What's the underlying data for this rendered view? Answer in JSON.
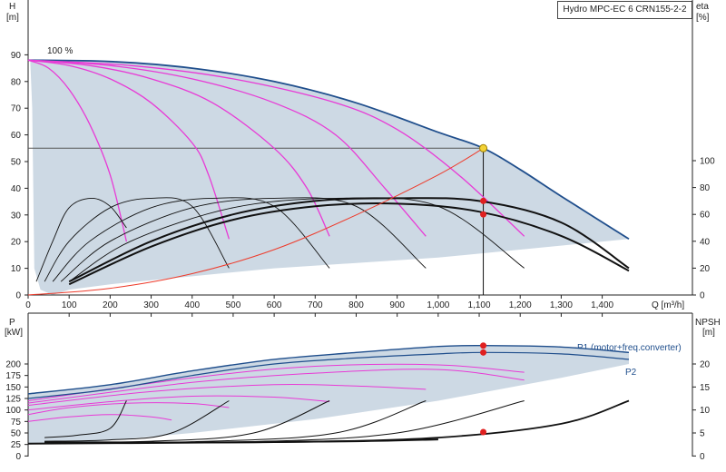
{
  "title_box": "Hydro MPC-EC 6 CRN155-2-2",
  "colors": {
    "envelope_fill": "#cdd9e4",
    "envelope_line": "#1f4e8c",
    "qh_curve": "#e83ad6",
    "efficiency_curve": "#111111",
    "system_curve": "#ee3a2a",
    "duty_point": "#f3d236",
    "marker": "#e02020",
    "axis": "#222222"
  },
  "chart_data": [
    {
      "type": "line",
      "name": "top",
      "xlabel": "Q [m³/h]",
      "ylabel": "H [m]",
      "y2label": "eta [%]",
      "y_axis_title": "H",
      "y_axis_unit": "[m]",
      "y2_axis_title": "eta",
      "y2_axis_unit": "[%]",
      "x_unit_label": "Q [m³/h]",
      "xlim": [
        0,
        1500
      ],
      "ylim": [
        0,
        95
      ],
      "y2lim": [
        0,
        117.5
      ],
      "x_ticks": [
        0,
        100,
        200,
        300,
        400,
        500,
        600,
        700,
        800,
        900,
        1000,
        1100,
        1200,
        1300,
        1400
      ],
      "x_tick_labels": [
        "0",
        "100",
        "200",
        "300",
        "400",
        "500",
        "600",
        "700",
        "800",
        "900",
        "1,000",
        "1,100",
        "1,200",
        "1,300",
        "1,400"
      ],
      "y_ticks": [
        0,
        10,
        20,
        30,
        40,
        50,
        60,
        70,
        80,
        90
      ],
      "y2_ticks": [
        0,
        20,
        40,
        60,
        80,
        100
      ],
      "annotation_100pct": "100 %",
      "envelope_upper": [
        [
          0,
          88
        ],
        [
          200,
          87.5
        ],
        [
          400,
          85
        ],
        [
          600,
          80
        ],
        [
          800,
          72
        ],
        [
          1000,
          61
        ],
        [
          1110,
          55
        ],
        [
          1200,
          47
        ],
        [
          1300,
          37
        ],
        [
          1465,
          21
        ]
      ],
      "envelope_lower": [
        [
          1465,
          21
        ],
        [
          1200,
          17
        ],
        [
          1000,
          14
        ],
        [
          800,
          12
        ],
        [
          600,
          10
        ],
        [
          400,
          7
        ],
        [
          200,
          4
        ],
        [
          100,
          2
        ],
        [
          60,
          0
        ],
        [
          30,
          2
        ],
        [
          15,
          10
        ],
        [
          10,
          70
        ],
        [
          5,
          88
        ]
      ],
      "qh_curves_full_speed": [
        {
          "name": "1 pump",
          "values": [
            [
              0,
              88
            ],
            [
              50,
              85
            ],
            [
              100,
              77
            ],
            [
              150,
              64
            ],
            [
              200,
              45
            ],
            [
              240,
              20
            ]
          ]
        },
        {
          "name": "2 pumps",
          "values": [
            [
              0,
              88
            ],
            [
              100,
              86
            ],
            [
              200,
              81
            ],
            [
              300,
              72
            ],
            [
              400,
              57
            ],
            [
              440,
              45
            ],
            [
              490,
              21
            ]
          ]
        },
        {
          "name": "3 pumps",
          "values": [
            [
              0,
              88
            ],
            [
              150,
              86
            ],
            [
              300,
              81
            ],
            [
              450,
              72
            ],
            [
              600,
              55
            ],
            [
              680,
              40
            ],
            [
              735,
              22
            ]
          ]
        },
        {
          "name": "4 pumps",
          "values": [
            [
              0,
              88
            ],
            [
              200,
              86
            ],
            [
              400,
              81
            ],
            [
              600,
              72
            ],
            [
              750,
              60
            ],
            [
              870,
              40
            ],
            [
              970,
              22
            ]
          ]
        },
        {
          "name": "5 pumps",
          "values": [
            [
              0,
              88
            ],
            [
              250,
              86
            ],
            [
              500,
              81
            ],
            [
              750,
              72
            ],
            [
              900,
              62
            ],
            [
              1050,
              45
            ],
            [
              1210,
              22
            ]
          ]
        }
      ],
      "eta_curves": [
        {
          "name": "1 pump",
          "values": [
            [
              20,
              10
            ],
            [
              60,
              40
            ],
            [
              100,
              65
            ],
            [
              155,
              72
            ],
            [
              200,
              66
            ],
            [
              240,
              50
            ]
          ]
        },
        {
          "name": "2 pumps",
          "values": [
            [
              40,
              10
            ],
            [
              100,
              40
            ],
            [
              200,
              65
            ],
            [
              300,
              72
            ],
            [
              400,
              66
            ],
            [
              490,
              20
            ]
          ]
        },
        {
          "name": "3 pumps",
          "values": [
            [
              60,
              10
            ],
            [
              150,
              40
            ],
            [
              300,
              65
            ],
            [
              450,
              72
            ],
            [
              600,
              66
            ],
            [
              735,
              20
            ]
          ]
        },
        {
          "name": "4 pumps",
          "values": [
            [
              80,
              10
            ],
            [
              200,
              40
            ],
            [
              400,
              65
            ],
            [
              600,
              72
            ],
            [
              800,
              66
            ],
            [
              970,
              20
            ]
          ]
        },
        {
          "name": "5 pumps",
          "values": [
            [
              100,
              10
            ],
            [
              250,
              40
            ],
            [
              500,
              65
            ],
            [
              750,
              72
            ],
            [
              1000,
              66
            ],
            [
              1210,
              20
            ]
          ]
        }
      ],
      "eta_curves_overall": [
        {
          "name": "thick A",
          "values": [
            [
              100,
              10
            ],
            [
              300,
              40
            ],
            [
              500,
              60
            ],
            [
              700,
              70
            ],
            [
              900,
              72
            ],
            [
              1100,
              70
            ],
            [
              1300,
              54
            ],
            [
              1465,
              20
            ]
          ]
        },
        {
          "name": "thick B",
          "values": [
            [
              100,
              8
            ],
            [
              300,
              36
            ],
            [
              500,
              56
            ],
            [
              700,
              66
            ],
            [
              900,
              68
            ],
            [
              1100,
              62
            ],
            [
              1300,
              44
            ],
            [
              1465,
              18
            ]
          ]
        }
      ],
      "system_curve": [
        [
          0,
          0
        ],
        [
          200,
          2.5
        ],
        [
          400,
          8
        ],
        [
          600,
          17
        ],
        [
          800,
          30
        ],
        [
          1000,
          45
        ],
        [
          1110,
          55
        ]
      ],
      "duty_point": {
        "q": 1110,
        "h": 55
      },
      "duty_markers_eta": [
        {
          "q": 1110,
          "eta": 70
        },
        {
          "q": 1110,
          "eta": 60
        }
      ],
      "reference_line_h": 55
    },
    {
      "type": "line",
      "name": "bottom",
      "y_axis_title": "P",
      "y_axis_unit": "[kW]",
      "y2_axis_title": "NPSH",
      "y2_axis_unit": "[m]",
      "xlim": [
        0,
        1500
      ],
      "ylim": [
        0,
        250
      ],
      "y2lim": [
        0,
        25
      ],
      "y_ticks": [
        0,
        25,
        50,
        75,
        100,
        125,
        150,
        175,
        200
      ],
      "y2_ticks": [
        0,
        5,
        10,
        15,
        20
      ],
      "label_p1": "P1 (motor+freq.converter)",
      "label_p2": "P2",
      "p1_curve": [
        [
          0,
          135
        ],
        [
          200,
          155
        ],
        [
          400,
          185
        ],
        [
          600,
          210
        ],
        [
          800,
          225
        ],
        [
          1000,
          238
        ],
        [
          1110,
          240
        ],
        [
          1300,
          237
        ],
        [
          1465,
          225
        ]
      ],
      "p2_curve": [
        [
          0,
          125
        ],
        [
          200,
          145
        ],
        [
          400,
          175
        ],
        [
          600,
          200
        ],
        [
          800,
          213
        ],
        [
          1000,
          222
        ],
        [
          1110,
          225
        ],
        [
          1300,
          222
        ],
        [
          1465,
          210
        ]
      ],
      "power_curves": [
        [
          [
            0,
            75
          ],
          [
            100,
            85
          ],
          [
            200,
            90
          ],
          [
            300,
            85
          ],
          [
            350,
            78
          ]
        ],
        [
          [
            0,
            90
          ],
          [
            100,
            105
          ],
          [
            250,
            115
          ],
          [
            400,
            114
          ],
          [
            490,
            105
          ]
        ],
        [
          [
            0,
            100
          ],
          [
            200,
            118
          ],
          [
            400,
            130
          ],
          [
            600,
            128
          ],
          [
            735,
            118
          ]
        ],
        [
          [
            0,
            110
          ],
          [
            300,
            140
          ],
          [
            600,
            155
          ],
          [
            800,
            152
          ],
          [
            970,
            145
          ]
        ],
        [
          [
            0,
            120
          ],
          [
            400,
            170
          ],
          [
            700,
            195
          ],
          [
            1000,
            198
          ],
          [
            1210,
            182
          ]
        ],
        [
          [
            0,
            115
          ],
          [
            400,
            160
          ],
          [
            700,
            180
          ],
          [
            1000,
            188
          ],
          [
            1210,
            165
          ]
        ]
      ],
      "npsh_curves": [
        [
          [
            40,
            4
          ],
          [
            120,
            4.5
          ],
          [
            200,
            6
          ],
          [
            240,
            12
          ]
        ],
        [
          [
            40,
            3.2
          ],
          [
            200,
            3.5
          ],
          [
            350,
            5
          ],
          [
            490,
            12
          ]
        ],
        [
          [
            40,
            3
          ],
          [
            300,
            3.2
          ],
          [
            550,
            5
          ],
          [
            735,
            12
          ]
        ],
        [
          [
            40,
            3
          ],
          [
            400,
            3.1
          ],
          [
            750,
            5
          ],
          [
            970,
            12
          ]
        ],
        [
          [
            40,
            3
          ],
          [
            500,
            3
          ],
          [
            900,
            5
          ],
          [
            1210,
            12
          ]
        ],
        [
          [
            40,
            3
          ],
          [
            600,
            3
          ],
          [
            1000,
            4
          ],
          [
            1300,
            7
          ],
          [
            1465,
            12
          ]
        ]
      ],
      "markers": [
        {
          "q": 1110,
          "p": 240
        },
        {
          "q": 1110,
          "p": 225
        },
        {
          "q": 1110,
          "npsh": 5.2
        }
      ]
    }
  ]
}
